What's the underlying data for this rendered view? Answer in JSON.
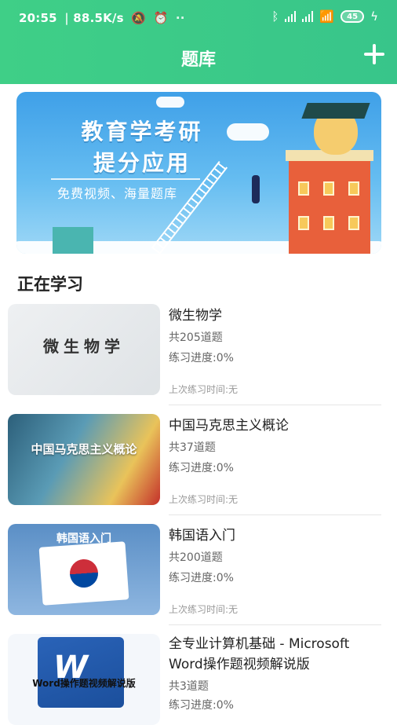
{
  "status_bar": {
    "time": "20:55",
    "speed": "88.5K/s",
    "battery": "45"
  },
  "header": {
    "title": "题库",
    "add_icon": "plus-icon"
  },
  "banner": {
    "title_line1": "教育学考研",
    "title_line2": "提分应用",
    "subtitle": "免费视频、海量题库"
  },
  "section": {
    "title": "正在学习"
  },
  "courses": [
    {
      "thumb_text": "微生物学",
      "name": "微生物学",
      "count": "共205道题",
      "progress_text": "练习进度:0%",
      "last": "上次练习时间:无"
    },
    {
      "thumb_text": "中国马克思主义概论",
      "name": "中国马克思主义概论",
      "count": "共37道题",
      "progress_text": "练习进度:0%",
      "last": "上次练习时间:无"
    },
    {
      "thumb_text": "韩国语入门",
      "name": "韩国语入门",
      "count": "共200道题",
      "progress_text": "练习进度:0%",
      "last": "上次练习时间:无"
    },
    {
      "thumb_text": "Word操作题视频解说版",
      "name": "全专业计算机基础 - Microsoft Word操作题视频解说版",
      "count": "共3道题",
      "progress_text": "练习进度:0%"
    }
  ],
  "colors": {
    "header_green": "#3fcf87",
    "banner_blue": "#3fa0e8"
  }
}
